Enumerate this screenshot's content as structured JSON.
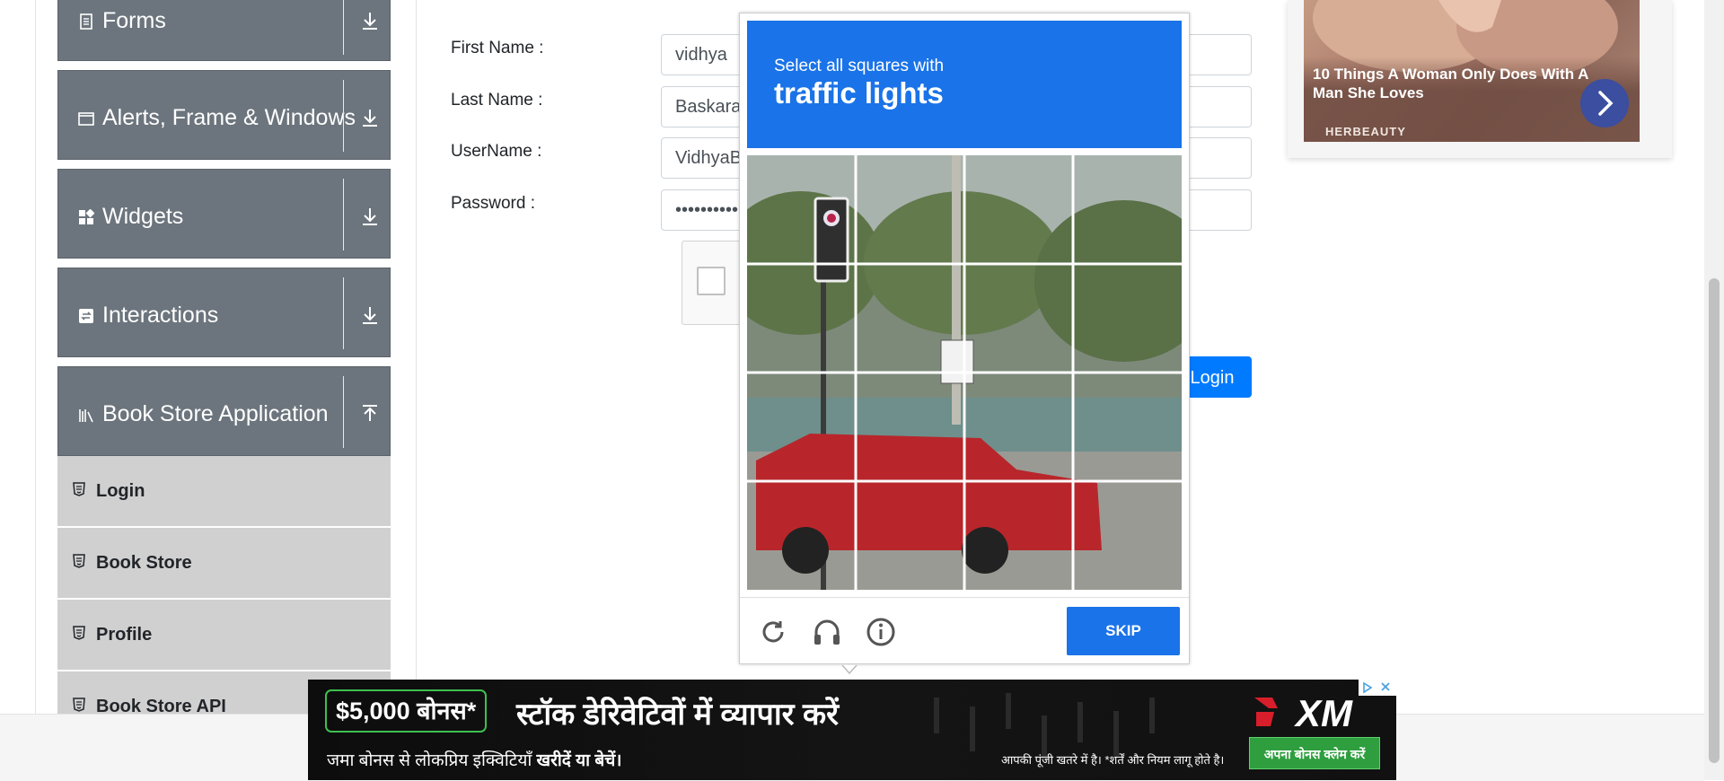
{
  "sidebar": {
    "groups": [
      {
        "title": "Forms",
        "icon": "document-icon",
        "arrow": "download-arrow-icon"
      },
      {
        "title": "Alerts, Frame & Windows",
        "icon": "window-icon",
        "arrow": "download-arrow-icon"
      },
      {
        "title": "Widgets",
        "icon": "widgets-icon",
        "arrow": "download-arrow-icon"
      },
      {
        "title": "Interactions",
        "icon": "interactions-icon",
        "arrow": "download-arrow-icon"
      },
      {
        "title": "Book Store Application",
        "icon": "books-icon",
        "arrow": "upload-arrow-icon"
      }
    ],
    "items": [
      {
        "label": "Login"
      },
      {
        "label": "Book Store"
      },
      {
        "label": "Profile"
      },
      {
        "label": "Book Store API"
      }
    ]
  },
  "form": {
    "first_name_label": "First Name :",
    "last_name_label": "Last Name :",
    "username_label": "UserName :",
    "password_label": "Password :",
    "first_name_value": "vidhya",
    "last_name_value": "Baskaran",
    "username_value": "VidhyaB",
    "password_value": "••••••••••",
    "login_label": "Login"
  },
  "captcha": {
    "prompt_line1": "Select all squares with",
    "prompt_line2": "traffic lights",
    "skip_label": "SKIP",
    "icons": [
      "reload-icon",
      "audio-headphones-icon",
      "info-icon"
    ]
  },
  "ad_right": {
    "headline": "10 Things A Woman Only Does With A Man She Loves",
    "brand": "HERBEAUTY"
  },
  "ad_bottom": {
    "bonus": "$5,000 बोनस*",
    "headline": "स्टॉक डेरिवेटिवों में व्यापार करें",
    "sub_prefix": "जमा बोनस से लोकप्रिय इक्विटियाँ",
    "sub_bold": "खरीदें या बेचें।",
    "logo_text": "XM",
    "disclaimer": "आपकी पूंजी खतरे में है। *शर्तें और नियम लागू होते है।",
    "cta": "अपना बोनस क्लेम करें"
  },
  "colors": {
    "sidebar_header": "#6c757d",
    "sidebar_item": "#d0d0d0",
    "primary": "#007bff",
    "captcha_blue": "#1a73e8"
  }
}
